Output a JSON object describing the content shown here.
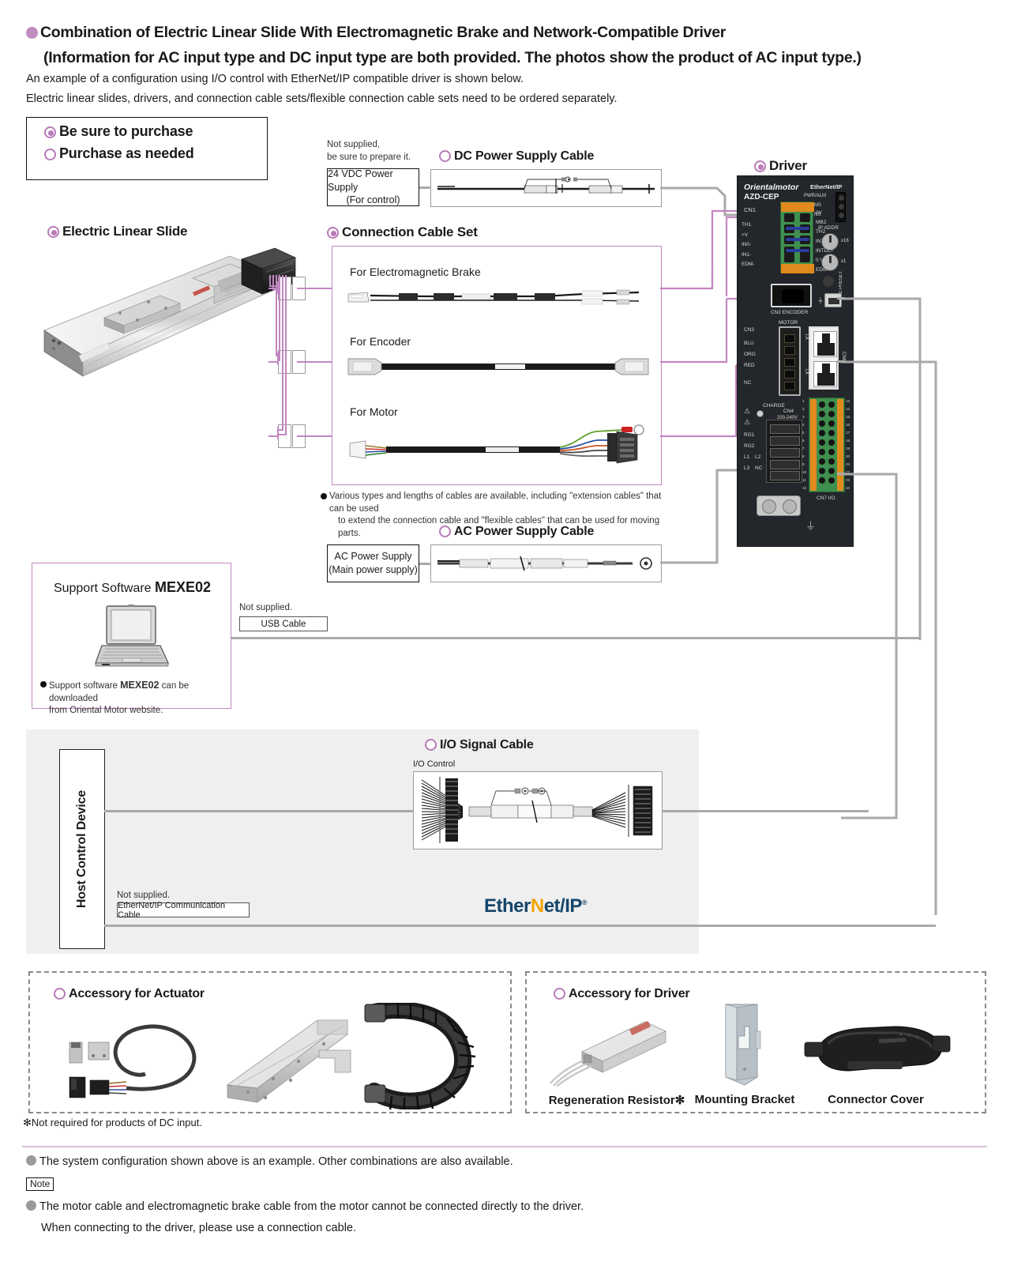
{
  "header": {
    "title_line1": "Combination of Electric Linear Slide With Electromagnetic Brake and Network-Compatible Driver",
    "title_line2": "(Information for AC input type and DC input type are both provided. The photos show the product of AC input type.)",
    "subtitle_line1": "An example of a configuration using I/O control with EtherNet/IP compatible driver is shown below.",
    "subtitle_line2": "Electric linear slides, drivers, and connection cable sets/flexible connection cable sets need to be ordered separately."
  },
  "legend": {
    "required_label": "Be sure to purchase",
    "optional_label": "Purchase as needed"
  },
  "sections": {
    "electric_linear_slide": "Electric Linear Slide",
    "connection_cable_set": "Connection Cable Set",
    "driver": "Driver",
    "dc_power_supply_cable": "DC Power Supply Cable",
    "ac_power_supply_cable": "AC Power Supply Cable",
    "io_signal_cable": "I/O Signal Cable",
    "accessory_for_actuator": "Accessory for Actuator",
    "accessory_for_driver": "Accessory for Driver"
  },
  "dc_supply": {
    "not_supplied_line1": "Not supplied,",
    "not_supplied_line2": "be sure to prepare it.",
    "box_line1": "24 VDC Power Supply",
    "box_line2": "(For control)"
  },
  "ac_supply": {
    "box_line1": "AC Power Supply",
    "box_line2": "(Main power supply)"
  },
  "cable_set": {
    "items": [
      {
        "label": "For Electromagnetic Brake"
      },
      {
        "label": "For Encoder"
      },
      {
        "label": "For Motor"
      }
    ],
    "note_line1": "Various types and lengths of cables are available, including \"extension cables\" that can be used",
    "note_line2": "to extend the connection cable and \"flexible cables\" that can be used for moving parts."
  },
  "driver_panel": {
    "brand": "Orientalmotor",
    "model": "AZD-CEP",
    "network": "EtherNet/IP",
    "cn1": "CN1",
    "left_terminals": [
      "TH1",
      "+V",
      "IN0-",
      "IN1-",
      "EDM-"
    ],
    "right_terminals": [
      "0V",
      "MB2",
      "TH2",
      "INTD1",
      "INTD2+",
      "0 V",
      "EDM+"
    ],
    "leds": [
      "PWR/ALM",
      "MS",
      "NS"
    ],
    "ip_addr": "IP ADDR",
    "rotary_x16": "x16",
    "rotary_x1": "x1",
    "home_preset": "HOME PRESET",
    "cn2_encoder": "CN2  ENCODER",
    "motor": "MOTOR",
    "cn3": "CN3",
    "motor_terminals": [
      "BLU",
      "ORG",
      "RED",
      "NC"
    ],
    "cn6": "CN6",
    "la": "LA",
    "lb": "LA",
    "charge": "CHARGE",
    "cn4": "CN4",
    "cn4_voltage": "200-240V",
    "rg1": "RG1",
    "rg2": "RG2",
    "l1": "L1",
    "l2": "L2",
    "l3": "L3",
    "nc": "NC",
    "cn7_io": "CN7 I/O",
    "io_left_numbers": [
      "1",
      "2",
      "3",
      "4",
      "5",
      "6",
      "7",
      "8",
      "9",
      "10",
      "11",
      "12"
    ],
    "io_right_numbers": [
      "13",
      "14",
      "15",
      "16",
      "17",
      "18",
      "19",
      "20",
      "21",
      "22",
      "23",
      "24"
    ]
  },
  "mexe": {
    "title_prefix": "Support Software ",
    "title_name": "MEXE02",
    "note_prefix": "Support software ",
    "note_name": "MEXE02",
    "note_suffix": " can be downloaded",
    "note_line2": "from Oriental Motor website."
  },
  "usb": {
    "not_supplied": "Not supplied.",
    "box_label": "USB Cable"
  },
  "host": {
    "label": "Host Control Device",
    "not_supplied": "Not supplied.",
    "ethernet_cable_label": "EtherNet/IP Communication Cable"
  },
  "io_cable": {
    "sub_label": "I/O Control"
  },
  "ethernet_logo": {
    "part1": "Ether",
    "accent": "N",
    "part2": "et/IP",
    "tm": "®"
  },
  "accessories_driver": {
    "items": [
      {
        "label": "Regeneration Resistor✻"
      },
      {
        "label": "Mounting Bracket"
      },
      {
        "label": "Connector Cover"
      }
    ]
  },
  "footnote": {
    "asterisk_note": "✻Not required for products of DC input.",
    "line1": "The system configuration shown above is an example. Other combinations are also available.",
    "note_badge": "Note",
    "line2": "The motor cable and electromagnetic brake cable from the motor cannot be connected directly to the driver.",
    "line3": "When connecting to the driver, please use a connection cable."
  },
  "colors": {
    "accent_pink": "#c187c1",
    "wire_gray": "#a9a9a9",
    "panel_gray": "#efefef",
    "enip_blue": "#15466b",
    "enip_orange": "#f0a500"
  }
}
